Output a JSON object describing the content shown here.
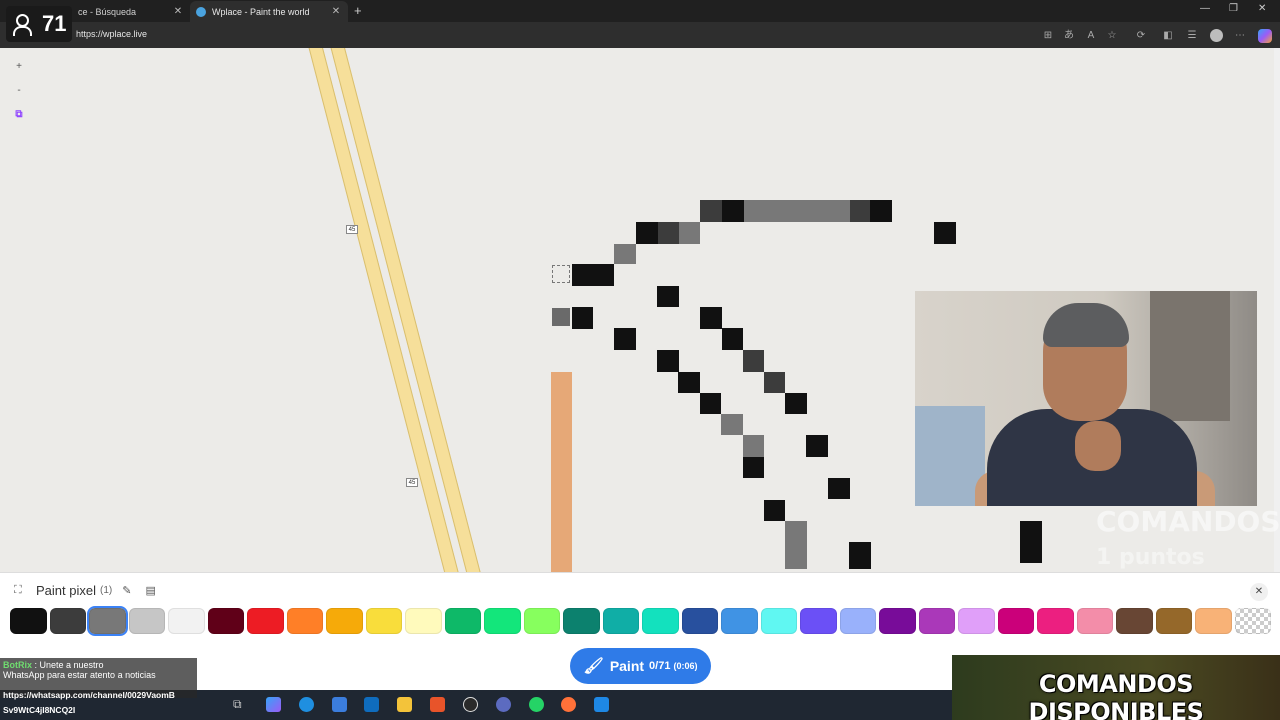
{
  "browser": {
    "tabs": [
      {
        "title": "ce - Búsqueda",
        "active": false
      },
      {
        "title": "Wplace - Paint the world",
        "active": true
      }
    ],
    "url": "https://wplace.live"
  },
  "stream": {
    "viewer_count": "71",
    "overlay_commands": "COMANDOS",
    "overlay_points": "1 puntos",
    "banner": "COMANDOS DISPONIBLES"
  },
  "map": {
    "zoom_in": "+",
    "zoom_out": "-",
    "route_label": "45"
  },
  "paint_panel": {
    "title": "Paint pixel",
    "count": "(1)",
    "palette": [
      "#111111",
      "#3c3c3c",
      "#787878",
      "#c6c6c6",
      "#f2f2f2",
      "#600018",
      "#ed1c24",
      "#ff7f27",
      "#f6aa09",
      "#f9dd3b",
      "#fffabc",
      "#0eb968",
      "#13e67b",
      "#87ff5e",
      "#0c816e",
      "#10aea6",
      "#13e1be",
      "#28509e",
      "#4093e4",
      "#60f7f2",
      "#6b50f6",
      "#99b1fb",
      "#780c99",
      "#aa38b9",
      "#e09ff9",
      "#cb007a",
      "#ec1f80",
      "#f38da9",
      "#684634",
      "#95682a",
      "#f8b277",
      "transparent"
    ],
    "selected_index": 2,
    "paint_button": {
      "label": "Paint",
      "charges": "0/71",
      "timer": "(0:06)"
    }
  },
  "chat": {
    "user": "BotRix",
    "line1": "Unete a nuestro",
    "line2": "WhatsApp para estar atento a noticias",
    "link1": "https://whatsapp.com/channel/0029VaomB",
    "link2": "Sv9WtC4jI8NCQ2I"
  }
}
